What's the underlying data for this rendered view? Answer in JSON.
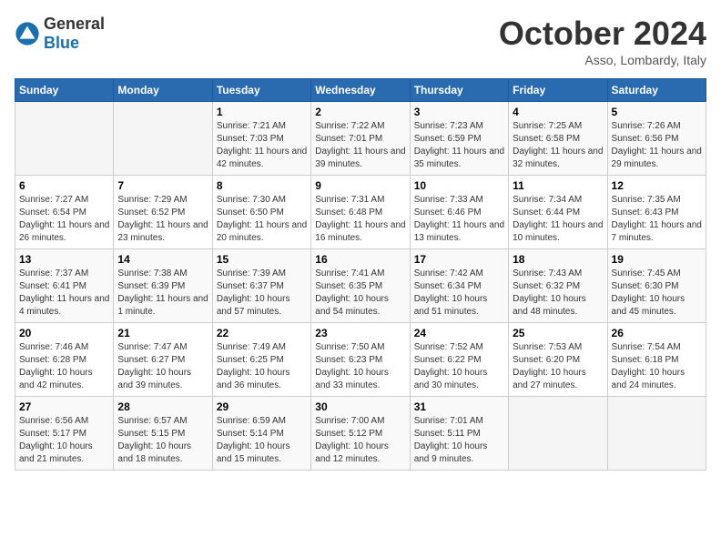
{
  "header": {
    "logo_general": "General",
    "logo_blue": "Blue",
    "month": "October 2024",
    "location": "Asso, Lombardy, Italy"
  },
  "columns": [
    "Sunday",
    "Monday",
    "Tuesday",
    "Wednesday",
    "Thursday",
    "Friday",
    "Saturday"
  ],
  "weeks": [
    [
      {
        "day": "",
        "info": ""
      },
      {
        "day": "",
        "info": ""
      },
      {
        "day": "1",
        "info": "Sunrise: 7:21 AM\nSunset: 7:03 PM\nDaylight: 11 hours and 42 minutes."
      },
      {
        "day": "2",
        "info": "Sunrise: 7:22 AM\nSunset: 7:01 PM\nDaylight: 11 hours and 39 minutes."
      },
      {
        "day": "3",
        "info": "Sunrise: 7:23 AM\nSunset: 6:59 PM\nDaylight: 11 hours and 35 minutes."
      },
      {
        "day": "4",
        "info": "Sunrise: 7:25 AM\nSunset: 6:58 PM\nDaylight: 11 hours and 32 minutes."
      },
      {
        "day": "5",
        "info": "Sunrise: 7:26 AM\nSunset: 6:56 PM\nDaylight: 11 hours and 29 minutes."
      }
    ],
    [
      {
        "day": "6",
        "info": "Sunrise: 7:27 AM\nSunset: 6:54 PM\nDaylight: 11 hours and 26 minutes."
      },
      {
        "day": "7",
        "info": "Sunrise: 7:29 AM\nSunset: 6:52 PM\nDaylight: 11 hours and 23 minutes."
      },
      {
        "day": "8",
        "info": "Sunrise: 7:30 AM\nSunset: 6:50 PM\nDaylight: 11 hours and 20 minutes."
      },
      {
        "day": "9",
        "info": "Sunrise: 7:31 AM\nSunset: 6:48 PM\nDaylight: 11 hours and 16 minutes."
      },
      {
        "day": "10",
        "info": "Sunrise: 7:33 AM\nSunset: 6:46 PM\nDaylight: 11 hours and 13 minutes."
      },
      {
        "day": "11",
        "info": "Sunrise: 7:34 AM\nSunset: 6:44 PM\nDaylight: 11 hours and 10 minutes."
      },
      {
        "day": "12",
        "info": "Sunrise: 7:35 AM\nSunset: 6:43 PM\nDaylight: 11 hours and 7 minutes."
      }
    ],
    [
      {
        "day": "13",
        "info": "Sunrise: 7:37 AM\nSunset: 6:41 PM\nDaylight: 11 hours and 4 minutes."
      },
      {
        "day": "14",
        "info": "Sunrise: 7:38 AM\nSunset: 6:39 PM\nDaylight: 11 hours and 1 minute."
      },
      {
        "day": "15",
        "info": "Sunrise: 7:39 AM\nSunset: 6:37 PM\nDaylight: 10 hours and 57 minutes."
      },
      {
        "day": "16",
        "info": "Sunrise: 7:41 AM\nSunset: 6:35 PM\nDaylight: 10 hours and 54 minutes."
      },
      {
        "day": "17",
        "info": "Sunrise: 7:42 AM\nSunset: 6:34 PM\nDaylight: 10 hours and 51 minutes."
      },
      {
        "day": "18",
        "info": "Sunrise: 7:43 AM\nSunset: 6:32 PM\nDaylight: 10 hours and 48 minutes."
      },
      {
        "day": "19",
        "info": "Sunrise: 7:45 AM\nSunset: 6:30 PM\nDaylight: 10 hours and 45 minutes."
      }
    ],
    [
      {
        "day": "20",
        "info": "Sunrise: 7:46 AM\nSunset: 6:28 PM\nDaylight: 10 hours and 42 minutes."
      },
      {
        "day": "21",
        "info": "Sunrise: 7:47 AM\nSunset: 6:27 PM\nDaylight: 10 hours and 39 minutes."
      },
      {
        "day": "22",
        "info": "Sunrise: 7:49 AM\nSunset: 6:25 PM\nDaylight: 10 hours and 36 minutes."
      },
      {
        "day": "23",
        "info": "Sunrise: 7:50 AM\nSunset: 6:23 PM\nDaylight: 10 hours and 33 minutes."
      },
      {
        "day": "24",
        "info": "Sunrise: 7:52 AM\nSunset: 6:22 PM\nDaylight: 10 hours and 30 minutes."
      },
      {
        "day": "25",
        "info": "Sunrise: 7:53 AM\nSunset: 6:20 PM\nDaylight: 10 hours and 27 minutes."
      },
      {
        "day": "26",
        "info": "Sunrise: 7:54 AM\nSunset: 6:18 PM\nDaylight: 10 hours and 24 minutes."
      }
    ],
    [
      {
        "day": "27",
        "info": "Sunrise: 6:56 AM\nSunset: 5:17 PM\nDaylight: 10 hours and 21 minutes."
      },
      {
        "day": "28",
        "info": "Sunrise: 6:57 AM\nSunset: 5:15 PM\nDaylight: 10 hours and 18 minutes."
      },
      {
        "day": "29",
        "info": "Sunrise: 6:59 AM\nSunset: 5:14 PM\nDaylight: 10 hours and 15 minutes."
      },
      {
        "day": "30",
        "info": "Sunrise: 7:00 AM\nSunset: 5:12 PM\nDaylight: 10 hours and 12 minutes."
      },
      {
        "day": "31",
        "info": "Sunrise: 7:01 AM\nSunset: 5:11 PM\nDaylight: 10 hours and 9 minutes."
      },
      {
        "day": "",
        "info": ""
      },
      {
        "day": "",
        "info": ""
      }
    ]
  ]
}
